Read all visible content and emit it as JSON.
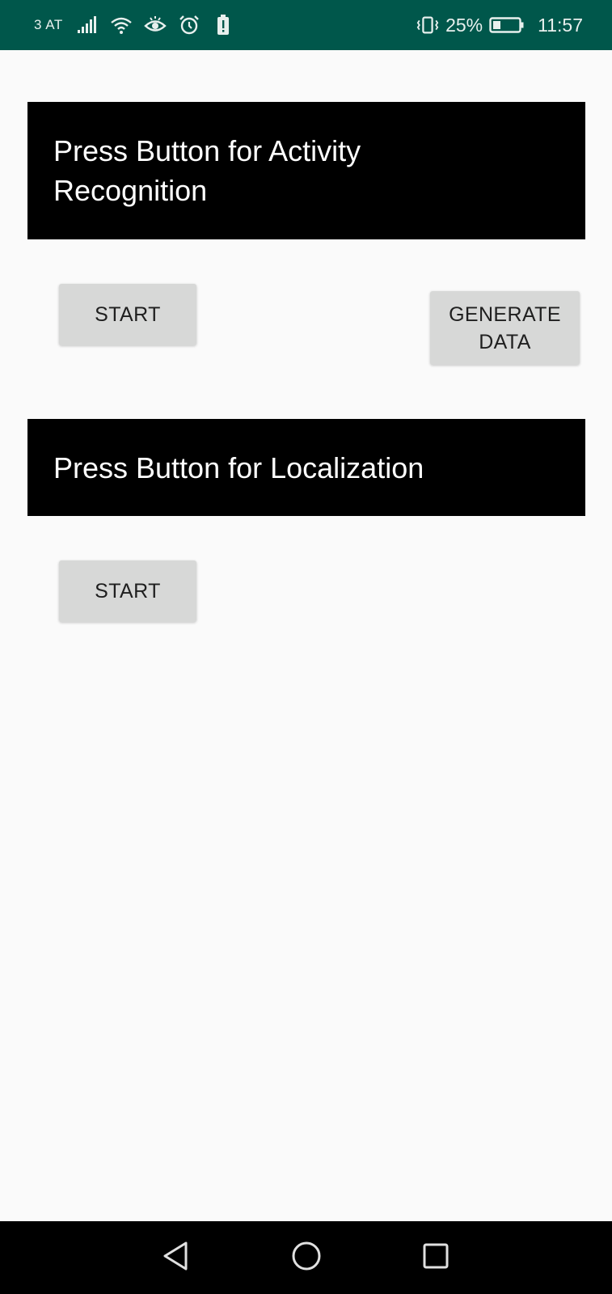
{
  "status_bar": {
    "carrier": "3 AT",
    "icons": [
      "signal-icon",
      "wifi-icon",
      "eye-icon",
      "alarm-icon",
      "battery-alert-icon",
      "vibrate-icon",
      "battery-icon"
    ],
    "battery_percent": "25%",
    "time": "11:57",
    "background_color": "#00574b"
  },
  "activity_section": {
    "title": "Press Button for Activity Recognition",
    "start_label": "START",
    "generate_label": "GENERATE DATA"
  },
  "localization_section": {
    "title": "Press Button for Localization",
    "start_label": "START"
  },
  "nav_bar": {
    "icons": [
      "back-icon",
      "home-icon",
      "recents-icon"
    ]
  },
  "colors": {
    "header_background": "#000000",
    "header_text": "#ffffff",
    "button_background": "#d7d8d7",
    "page_background": "#fafafa"
  }
}
